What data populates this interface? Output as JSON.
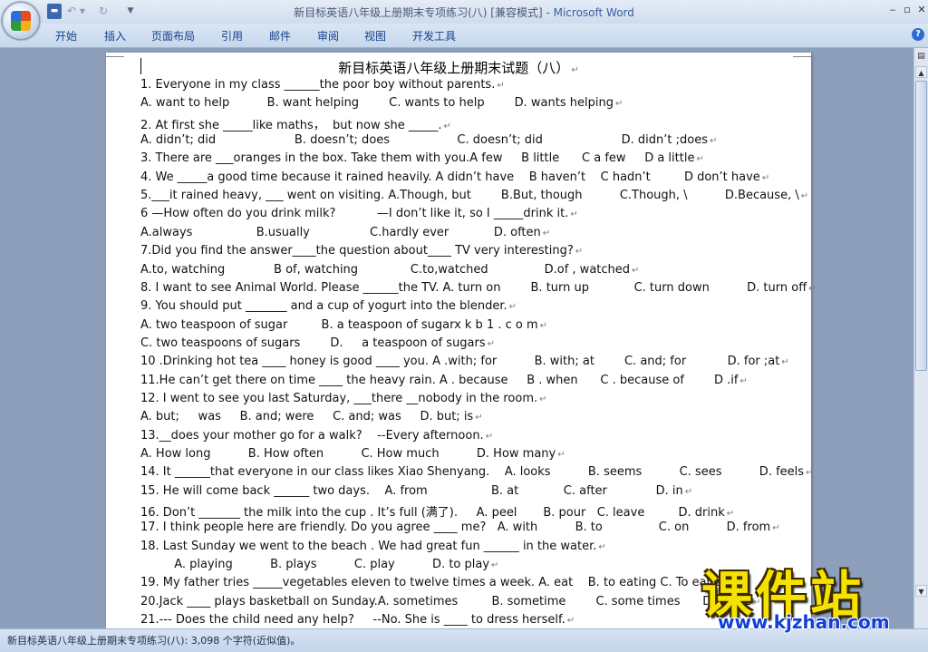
{
  "window": {
    "title": "新目标英语八年级上册期末专项练习(八) [兼容模式]",
    "separator": " - ",
    "app": "Microsoft Word",
    "min": "‒",
    "max": "▫",
    "close": "✕"
  },
  "quick_access": {
    "save": "▬",
    "undo": "↶ ▾",
    "redo": "↻",
    "more": "▼"
  },
  "ribbon": {
    "tabs": [
      "开始",
      "插入",
      "页面布局",
      "引用",
      "邮件",
      "审阅",
      "视图",
      "开发工具"
    ],
    "help": "?"
  },
  "document": {
    "title": "新目标英语八年级上册期末试题（八）",
    "lines": [
      "1. Everyone in my class ______the poor boy without parents.",
      "A. want to help          B. want helping        C. wants to help        D. wants helping",
      "2. At first she _____like maths，  but now she _____.",
      "A. didn’t; did                     B. doesn’t; does                  C. doesn’t; did                     D. didn’t ;does",
      "3. There are ___oranges in the box. Take them with you.A few     B little      C a few     D a little",
      "4. We _____a good time because it rained heavily. A didn’t have    B haven’t    C hadn’t         D don’t have",
      "5.___it rained heavy, ___ went on visiting. A.Though, but        B.But, though          C.Though, \\          D.Because, \\",
      "6 —How often do you drink milk?           —I don’t like it, so I _____drink it.",
      "A.always                 B.usually                C.hardly ever            D. often",
      "7.Did you find the answer____the question about____ TV very interesting?",
      "A.to, watching             B of, watching              C.to,watched               D.of , watched",
      "8. I want to see Animal World. Please ______the TV. A. turn on        B. turn up            C. turn down          D. turn off",
      "9. You should put _______ and a cup of yogurt into the blender.",
      "A. two teaspoon of sugar         B. a teaspoon of sugarx k b 1 . c o m",
      "C. two teaspoons of sugars        D.     a teaspoon of sugars",
      "10 .Drinking hot tea ____ honey is good ____ you. A .with; for          B. with; at        C. and; for           D. for ;at",
      "11.He can’t get there on time ____ the heavy rain. A . because     B . when      C . because of        D .if",
      "12. I went to see you last Saturday, ___there __nobody in the room.",
      "A. but;     was     B. and; were     C. and; was     D. but; is",
      "13.__does your mother go for a walk?    --Every afternoon.",
      "A. How long          B. How often          C. How much          D. How many",
      "14. It ______that everyone in our class likes Xiao Shenyang.    A. looks          B. seems          C. sees          D. feels",
      "15. He will come back ______ two days.    A. from                 B. at            C. after             D. in",
      "16. Don’t _______ the milk into the cup . It’s full (满了).     A. peel       B. pour   C. leave         D. drink",
      "17. I think people here are friendly. Do you agree ____ me?   A. with          B. to               C. on          D. from",
      "18. Last Sunday we went to the beach . We had great fun ______ in the water.",
      "         A. playing          B. plays          C. play          D. to play",
      "19. My father tries _____vegetables eleven to twelve times a week. A. eat    B. to eating C. To eat D.",
      "20.Jack ____ plays basketball on Sunday.A. sometimes         B. sometime        C. some times      D. some",
      "21.--- Does the child need any help?     --No. She is ____ to dress herself."
    ],
    "paragraph_mark": "↵"
  },
  "status": {
    "text": "新目标英语八年级上册期末专项练习(八): 3,098 个字符(近似值)。"
  },
  "scrollbar": {
    "ruler_icon": "▤",
    "up": "▲",
    "down": "▼"
  },
  "watermark": {
    "title": "课件站",
    "url": "www.kjzhan.com"
  }
}
